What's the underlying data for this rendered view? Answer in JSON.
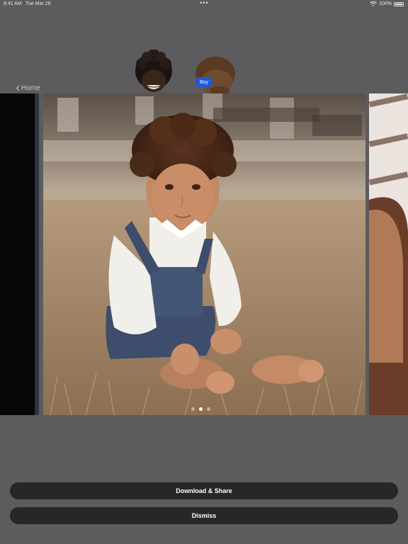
{
  "status_bar": {
    "time": "8:41 AM",
    "date": "Tue Mar 26",
    "battery_percent": "100%",
    "battery_level": 1.0
  },
  "nav": {
    "back_label": "Home"
  },
  "avatars": {
    "badge_label": "Boy"
  },
  "carousel": {
    "page_count": 3,
    "current_page": 2
  },
  "actions": {
    "download_label": "Download & Share",
    "dismiss_label": "Dismiss"
  },
  "colors": {
    "background": "#5c5c5e",
    "button": "#27272a",
    "badge": "#1e5ad6"
  },
  "icons": [
    "wifi-icon",
    "battery-icon",
    "chevron-left-icon",
    "multitasking-dots-icon"
  ]
}
